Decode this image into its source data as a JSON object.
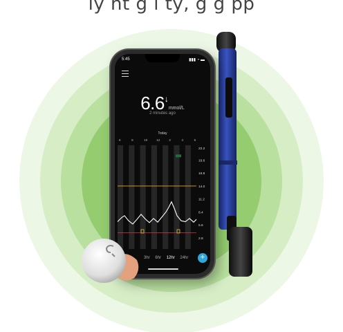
{
  "caption": "ly   nt       g   l     ty, g  g  pp",
  "phone": {
    "status_time": "5:45",
    "status_icons": "▮▮▮ ◔ ▬",
    "glucose_value": "6.6",
    "trend_arrow": "↓",
    "unit": "mmol/L",
    "updated": "2 minutes ago",
    "date_label": "Today",
    "x_ticks": [
      "6",
      "8",
      "10",
      "12",
      "2",
      "4",
      "6"
    ],
    "y_ticks": [
      "22.2",
      "19.6",
      "16.8",
      "14.0",
      "11.2",
      "8.4",
      "5.6",
      "2.8"
    ],
    "ranges": [
      "3hr",
      "6hr",
      "12hr",
      "24hr"
    ],
    "active_range": "12hr",
    "add_label": "+"
  },
  "colors": {
    "ring_outer": "#e3f2d7",
    "ring_mid": "#c9e7b5",
    "ring_inner": "#a9d98c",
    "ring_core": "#84c45f",
    "high_line": "#e8a52a",
    "low_line": "#e0324b",
    "pen_blue": "#2a3f9e",
    "fab": "#2fa8d8"
  }
}
